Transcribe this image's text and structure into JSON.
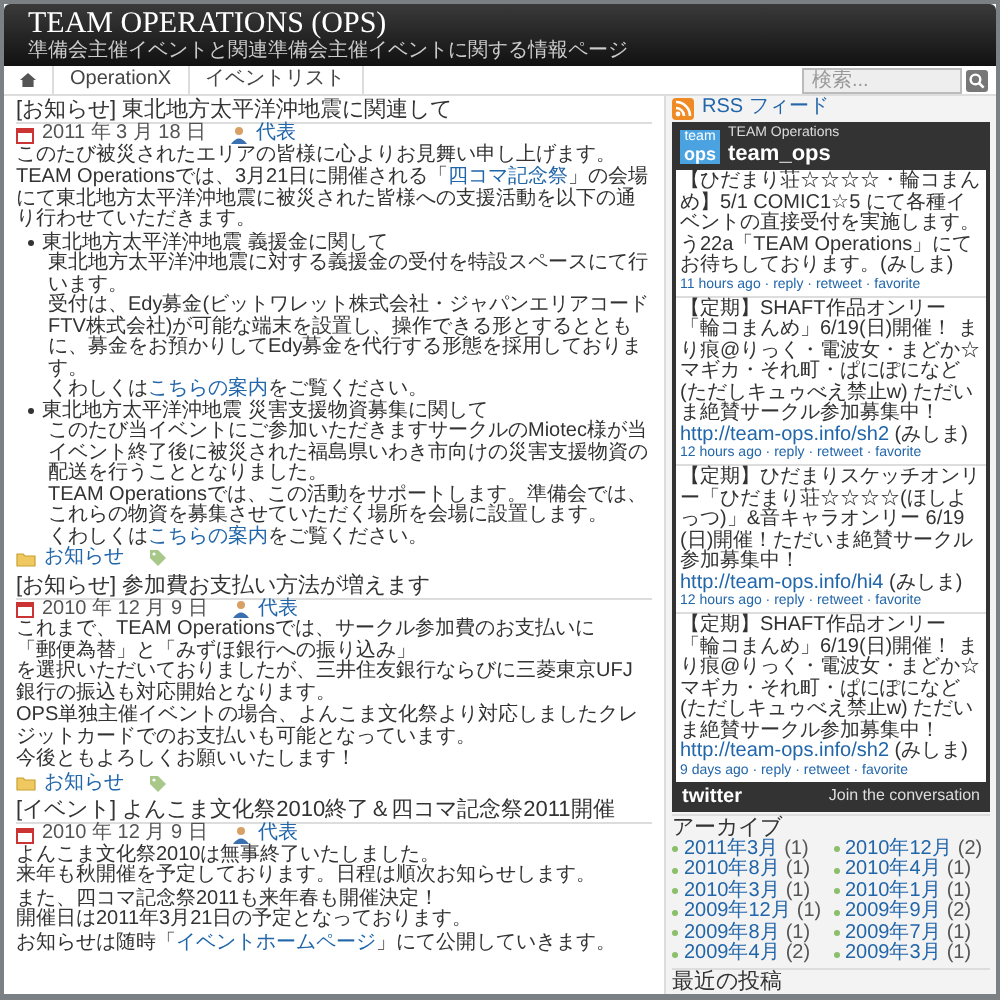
{
  "header": {
    "title": "TEAM OPERATIONS (OPS)",
    "tagline": "準備会主催イベントと関連準備会主催イベントに関する情報ページ"
  },
  "nav": {
    "items": [
      {
        "kind": "home"
      },
      {
        "kind": "link",
        "label": "OperationX"
      },
      {
        "kind": "link",
        "label": "イベントリスト"
      }
    ],
    "search": {
      "placeholder": "検索..."
    }
  },
  "posts": [
    {
      "title": "[お知らせ] 東北地方太平洋沖地震に関連して",
      "date": "2011 年 3 月 18 日",
      "author": "代表",
      "blocks": [
        {
          "kind": "paragraph",
          "lines": [
            "このたび被災されたエリアの皆様に心よりお見舞い申し上げます。"
          ]
        },
        {
          "kind": "paragraph",
          "lines": [
            [
              {
                "kind": "text",
                "text": "TEAM Operationsでは、3月21日に開催される「"
              },
              {
                "kind": "link",
                "text": "四コマ記念祭"
              },
              {
                "kind": "text",
                "text": "」の会場にて東北地方太平洋沖地震に被災された皆様への支援活動を以下の通り行わせていただきます。"
              }
            ]
          ]
        },
        {
          "kind": "bullet",
          "heading": "東北地方太平洋沖地震 義援金に関して",
          "lines": [
            "東北地方太平洋沖地震に対する義援金の受付を特設スペースにて行います。",
            "受付は、Edy募金(ビットワレット株式会社・ジャパンエリアコードFTV株式会社)が可能な端末を設置し、操作できる形とするとともに、募金をお預かりしてEdy募金を代行する形態を採用しております。",
            [
              {
                "kind": "text",
                "text": "くわしくは"
              },
              {
                "kind": "link",
                "text": "こちらの案内"
              },
              {
                "kind": "text",
                "text": "をご覧ください。"
              }
            ]
          ]
        },
        {
          "kind": "bullet",
          "heading": "東北地方太平洋沖地震 災害支援物資募集に関して",
          "lines": [
            "このたび当イベントにご参加いただきますサークルのMiotec様が当イベント終了後に被災された福島県いわき市向けの災害支援物資の配送を行うこととなりました。",
            "TEAM Operationsでは、この活動をサポートします。準備会では、これらの物資を募集させていただく場所を会場に設置します。",
            [
              {
                "kind": "text",
                "text": "くわしくは"
              },
              {
                "kind": "link",
                "text": "こちらの案内"
              },
              {
                "kind": "text",
                "text": "をご覧ください。"
              }
            ]
          ]
        }
      ],
      "category": "お知らせ"
    },
    {
      "title": "[お知らせ] 参加費お支払い方法が増えます",
      "date": "2010 年 12 月 9 日",
      "author": "代表",
      "blocks": [
        {
          "kind": "paragraph",
          "lines": [
            "これまで、TEAM Operationsでは、サークル参加費のお支払いに",
            "「郵便為替」と「みずほ銀行への振り込み」",
            "を選択いただいておりましたが、三井住友銀行ならびに三菱東京UFJ銀行の振込も対応開始となります。"
          ]
        },
        {
          "kind": "paragraph",
          "lines": [
            "OPS単独主催イベントの場合、よんこま文化祭より対応しましたクレジットカードでのお支払いも可能となっています。"
          ]
        },
        {
          "kind": "paragraph",
          "lines": [
            "今後ともよろしくお願いいたします！"
          ]
        }
      ],
      "category": "お知らせ"
    },
    {
      "title": "[イベント] よんこま文化祭2010終了＆四コマ記念祭2011開催",
      "date": "2010 年 12 月 9 日",
      "author": "代表",
      "blocks": [
        {
          "kind": "paragraph",
          "lines": [
            "よんこま文化祭2010は無事終了いたしました。",
            "来年も秋開催を予定しております。日程は順次お知らせします。"
          ]
        },
        {
          "kind": "paragraph",
          "lines": [
            "また、四コマ記念祭2011も来年春も開催決定！",
            "開催日は2011年3月21日の予定となっております。"
          ]
        },
        {
          "kind": "paragraph",
          "lines": [
            [
              {
                "kind": "text",
                "text": "お知らせは随時「"
              },
              {
                "kind": "link",
                "text": "イベントホームページ"
              },
              {
                "kind": "text",
                "text": "」にて公開していきます。"
              }
            ]
          ]
        }
      ]
    }
  ],
  "sidebar": {
    "rss": "RSS フィード",
    "twitter": {
      "logo_top": "team",
      "logo_bottom": "ops",
      "account": "TEAM Operations",
      "handle": "team_ops",
      "tweets": [
        {
          "segments": [
            {
              "kind": "text",
              "text": "【ひだまり荘☆☆☆☆・輪コまんめ】5/1 COMIC1☆5 にて各種イベントの直接受付を実施します。う22a「TEAM Operations」にてお待ちしております。(みしま)"
            }
          ],
          "meta": "11 hours ago · reply · retweet · favorite"
        },
        {
          "segments": [
            {
              "kind": "text",
              "text": "【定期】SHAFT作品オンリー「輪コまんめ」6/19(日)開催！ まり痕@りっく・電波女・まどか☆マギカ・それ町・ぱにぽになど(ただしキュゥべえ禁止w) ただいま絶賛サークル参加募集中！ "
            },
            {
              "kind": "link",
              "text": "http://team-ops.info/sh2"
            },
            {
              "kind": "text",
              "text": " (みしま)"
            }
          ],
          "meta": "12 hours ago · reply · retweet · favorite"
        },
        {
          "segments": [
            {
              "kind": "text",
              "text": "【定期】ひだまりスケッチオンリー「ひだまり荘☆☆☆☆(ほしよっつ)」&音キャラオンリー 6/19(日)開催！ただいま絶賛サークル参加募集中！ "
            },
            {
              "kind": "link",
              "text": "http://team-ops.info/hi4"
            },
            {
              "kind": "text",
              "text": " (みしま)"
            }
          ],
          "meta": "12 hours ago · reply · retweet · favorite"
        },
        {
          "segments": [
            {
              "kind": "text",
              "text": "【定期】SHAFT作品オンリー「輪コまんめ」6/19(日)開催！ まり痕@りっく・電波女・まどか☆マギカ・それ町・ぱにぽになど(ただしキュゥべえ禁止w) ただいま絶賛サークル参加募集中！ "
            },
            {
              "kind": "link",
              "text": "http://team-ops.info/sh2"
            },
            {
              "kind": "text",
              "text": " (みしま)"
            }
          ],
          "meta": "9 days ago · reply · retweet · favorite"
        }
      ],
      "footer_logo": "twitter",
      "footer_link": "Join the conversation"
    },
    "archive": {
      "title": "アーカイブ",
      "items": [
        {
          "label": "2011年3月",
          "count": "(1)"
        },
        {
          "label": "2010年12月",
          "count": "(2)"
        },
        {
          "label": "2010年8月",
          "count": "(1)"
        },
        {
          "label": "2010年4月",
          "count": "(1)"
        },
        {
          "label": "2010年3月",
          "count": "(1)"
        },
        {
          "label": "2010年1月",
          "count": "(1)"
        },
        {
          "label": "2009年12月",
          "count": "(1)"
        },
        {
          "label": "2009年9月",
          "count": "(2)"
        },
        {
          "label": "2009年8月",
          "count": "(1)"
        },
        {
          "label": "2009年7月",
          "count": "(1)"
        },
        {
          "label": "2009年4月",
          "count": "(2)"
        },
        {
          "label": "2009年3月",
          "count": "(1)"
        }
      ]
    },
    "recent": {
      "title": "最近の投稿"
    }
  }
}
